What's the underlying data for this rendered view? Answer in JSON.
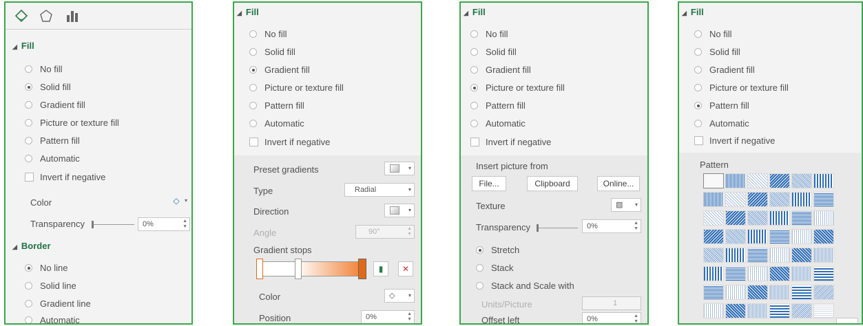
{
  "panel1": {
    "fill_section": "Fill",
    "fill_options": [
      {
        "label": "No fill",
        "checked": false
      },
      {
        "label": "Solid fill",
        "checked": true
      },
      {
        "label": "Gradient fill",
        "checked": false
      },
      {
        "label": "Picture or texture fill",
        "checked": false
      },
      {
        "label": "Pattern fill",
        "checked": false
      },
      {
        "label": "Automatic",
        "checked": false
      }
    ],
    "invert_label": "Invert if negative",
    "color_label": "Color",
    "transparency_label": "Transparency",
    "transparency_value": "0%",
    "border_section": "Border",
    "border_options": [
      {
        "label": "No line",
        "checked": true
      },
      {
        "label": "Solid line",
        "checked": false
      },
      {
        "label": "Gradient line",
        "checked": false
      },
      {
        "label": "Automatic",
        "checked": false
      }
    ]
  },
  "panel2": {
    "fill_section": "Fill",
    "fill_options": [
      {
        "label": "No fill",
        "checked": false
      },
      {
        "label": "Solid fill",
        "checked": false
      },
      {
        "label": "Gradient fill",
        "checked": true
      },
      {
        "label": "Picture or texture fill",
        "checked": false
      },
      {
        "label": "Pattern fill",
        "checked": false
      },
      {
        "label": "Automatic",
        "checked": false
      }
    ],
    "invert_label": "Invert if negative",
    "preset_label": "Preset gradients",
    "type_label": "Type",
    "type_value": "Radial",
    "direction_label": "Direction",
    "angle_label": "Angle",
    "angle_value": "90°",
    "stops_label": "Gradient stops",
    "color_label": "Color",
    "position_label": "Position",
    "position_value": "0%",
    "gradient_colors": [
      "#ffffff",
      "#f07a2a"
    ]
  },
  "panel3": {
    "fill_section": "Fill",
    "fill_options": [
      {
        "label": "No fill",
        "checked": false
      },
      {
        "label": "Solid fill",
        "checked": false
      },
      {
        "label": "Gradient fill",
        "checked": false
      },
      {
        "label": "Picture or texture fill",
        "checked": true
      },
      {
        "label": "Pattern fill",
        "checked": false
      },
      {
        "label": "Automatic",
        "checked": false
      }
    ],
    "invert_label": "Invert if negative",
    "insert_label": "Insert picture from",
    "file_button": "File...",
    "clipboard_button": "Clipboard",
    "online_button": "Online...",
    "texture_label": "Texture",
    "transparency_label": "Transparency",
    "transparency_value": "0%",
    "stretch_options": [
      {
        "label": "Stretch",
        "checked": true
      },
      {
        "label": "Stack",
        "checked": false
      },
      {
        "label": "Stack and Scale with",
        "checked": false
      }
    ],
    "units_label": "Units/Picture",
    "units_value": "1",
    "offset_label": "Offset left",
    "offset_value": "0%"
  },
  "panel4": {
    "fill_section": "Fill",
    "fill_options": [
      {
        "label": "No fill",
        "checked": false
      },
      {
        "label": "Solid fill",
        "checked": false
      },
      {
        "label": "Gradient fill",
        "checked": false
      },
      {
        "label": "Picture or texture fill",
        "checked": false
      },
      {
        "label": "Pattern fill",
        "checked": true
      },
      {
        "label": "Automatic",
        "checked": false
      }
    ],
    "invert_label": "Invert if negative",
    "pattern_label": "Pattern",
    "pattern_color": "#2f6db5"
  }
}
